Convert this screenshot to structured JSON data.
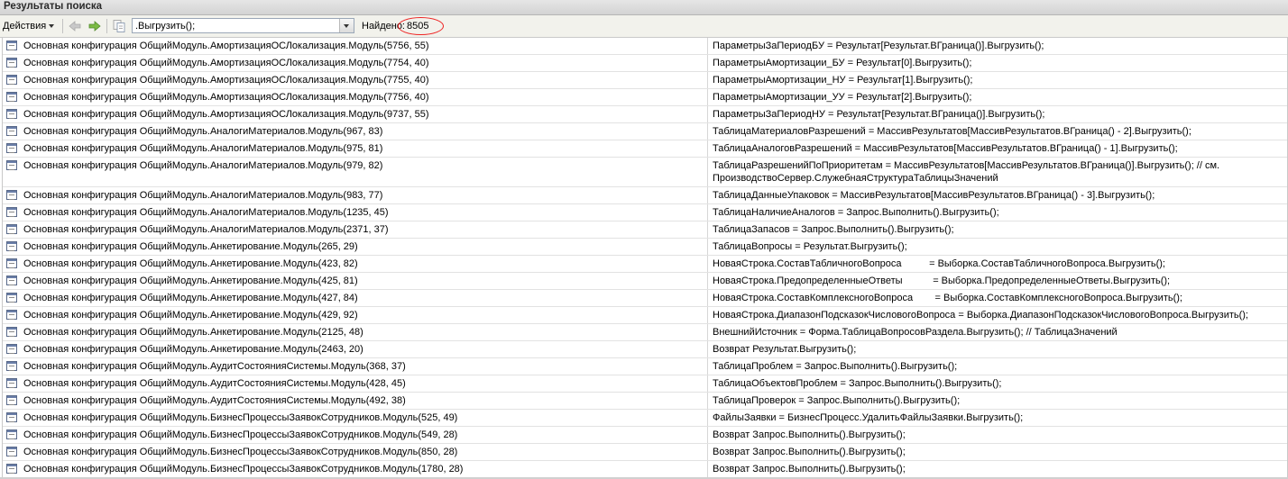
{
  "window": {
    "title": "Результаты поиска"
  },
  "toolbar": {
    "actions_label": "Действия",
    "search_value": ".Выгрузить();",
    "found_label": "Найдено:",
    "found_count": "8505"
  },
  "results": [
    {
      "location": "Основная конфигурация ОбщийМодуль.АмортизацияОСЛокализация.Модуль(5756, 55)",
      "code": "ПараметрыЗаПериодБУ = Результат[Результат.ВГраница()].Выгрузить();"
    },
    {
      "location": "Основная конфигурация ОбщийМодуль.АмортизацияОСЛокализация.Модуль(7754, 40)",
      "code": "ПараметрыАмортизации_БУ = Результат[0].Выгрузить();"
    },
    {
      "location": "Основная конфигурация ОбщийМодуль.АмортизацияОСЛокализация.Модуль(7755, 40)",
      "code": "ПараметрыАмортизации_НУ = Результат[1].Выгрузить();"
    },
    {
      "location": "Основная конфигурация ОбщийМодуль.АмортизацияОСЛокализация.Модуль(7756, 40)",
      "code": "ПараметрыАмортизации_УУ = Результат[2].Выгрузить();"
    },
    {
      "location": "Основная конфигурация ОбщийМодуль.АмортизацияОСЛокализация.Модуль(9737, 55)",
      "code": "ПараметрыЗаПериодНУ = Результат[Результат.ВГраница()].Выгрузить();"
    },
    {
      "location": "Основная конфигурация ОбщийМодуль.АналогиМатериалов.Модуль(967, 83)",
      "code": "ТаблицаМатериаловРазрешений = МассивРезультатов[МассивРезультатов.ВГраница() - 2].Выгрузить();"
    },
    {
      "location": "Основная конфигурация ОбщийМодуль.АналогиМатериалов.Модуль(975, 81)",
      "code": "ТаблицаАналоговРазрешений = МассивРезультатов[МассивРезультатов.ВГраница() - 1].Выгрузить();"
    },
    {
      "location": "Основная конфигурация ОбщийМодуль.АналогиМатериалов.Модуль(979, 82)",
      "code": "ТаблицаРазрешенийПоПриоритетам = МассивРезультатов[МассивРезультатов.ВГраница()].Выгрузить(); // см.\nПроизводствоСервер.СлужебнаяСтруктураТаблицыЗначений"
    },
    {
      "location": "Основная конфигурация ОбщийМодуль.АналогиМатериалов.Модуль(983, 77)",
      "code": "ТаблицаДанныеУпаковок = МассивРезультатов[МассивРезультатов.ВГраница() - 3].Выгрузить();"
    },
    {
      "location": "Основная конфигурация ОбщийМодуль.АналогиМатериалов.Модуль(1235, 45)",
      "code": "ТаблицаНаличиеАналогов = Запрос.Выполнить().Выгрузить();"
    },
    {
      "location": "Основная конфигурация ОбщийМодуль.АналогиМатериалов.Модуль(2371, 37)",
      "code": "ТаблицаЗапасов = Запрос.Выполнить().Выгрузить();"
    },
    {
      "location": "Основная конфигурация ОбщийМодуль.Анкетирование.Модуль(265, 29)",
      "code": "ТаблицаВопросы = Результат.Выгрузить();"
    },
    {
      "location": "Основная конфигурация ОбщийМодуль.Анкетирование.Модуль(423, 82)",
      "code": "НоваяСтрока.СоставТабличногоВопроса          = Выборка.СоставТабличногоВопроса.Выгрузить();"
    },
    {
      "location": "Основная конфигурация ОбщийМодуль.Анкетирование.Модуль(425, 81)",
      "code": "НоваяСтрока.ПредопределенныеОтветы           = Выборка.ПредопределенныеОтветы.Выгрузить();"
    },
    {
      "location": "Основная конфигурация ОбщийМодуль.Анкетирование.Модуль(427, 84)",
      "code": "НоваяСтрока.СоставКомплексногоВопроса        = Выборка.СоставКомплексногоВопроса.Выгрузить();"
    },
    {
      "location": "Основная конфигурация ОбщийМодуль.Анкетирование.Модуль(429, 92)",
      "code": "НоваяСтрока.ДиапазонПодсказокЧисловогоВопроса = Выборка.ДиапазонПодсказокЧисловогоВопроса.Выгрузить();"
    },
    {
      "location": "Основная конфигурация ОбщийМодуль.Анкетирование.Модуль(2125, 48)",
      "code": "ВнешнийИсточник = Форма.ТаблицаВопросовРаздела.Выгрузить(); // ТаблицаЗначений"
    },
    {
      "location": "Основная конфигурация ОбщийМодуль.Анкетирование.Модуль(2463, 20)",
      "code": "Возврат Результат.Выгрузить();"
    },
    {
      "location": "Основная конфигурация ОбщийМодуль.АудитСостоянияСистемы.Модуль(368, 37)",
      "code": "ТаблицаПроблем = Запрос.Выполнить().Выгрузить();"
    },
    {
      "location": "Основная конфигурация ОбщийМодуль.АудитСостоянияСистемы.Модуль(428, 45)",
      "code": "ТаблицаОбъектовПроблем = Запрос.Выполнить().Выгрузить();"
    },
    {
      "location": "Основная конфигурация ОбщийМодуль.АудитСостоянияСистемы.Модуль(492, 38)",
      "code": "ТаблицаПроверок = Запрос.Выполнить().Выгрузить();"
    },
    {
      "location": "Основная конфигурация ОбщийМодуль.БизнесПроцессыЗаявокСотрудников.Модуль(525, 49)",
      "code": "ФайлыЗаявки = БизнесПроцесс.УдалитьФайлыЗаявки.Выгрузить();"
    },
    {
      "location": "Основная конфигурация ОбщийМодуль.БизнесПроцессыЗаявокСотрудников.Модуль(549, 28)",
      "code": "Возврат Запрос.Выполнить().Выгрузить();"
    },
    {
      "location": "Основная конфигурация ОбщийМодуль.БизнесПроцессыЗаявокСотрудников.Модуль(850, 28)",
      "code": "Возврат Запрос.Выполнить().Выгрузить();"
    },
    {
      "location": "Основная конфигурация ОбщийМодуль.БизнесПроцессыЗаявокСотрудников.Модуль(1780, 28)",
      "code": "Возврат Запрос.Выполнить().Выгрузить();"
    }
  ],
  "icons": {
    "back": "back-arrow-icon",
    "forward": "forward-arrow-icon",
    "copy": "copy-icon",
    "row": "module-document-icon"
  },
  "colors": {
    "accent_green": "#6fa83a",
    "annotation_red": "#e22222"
  }
}
